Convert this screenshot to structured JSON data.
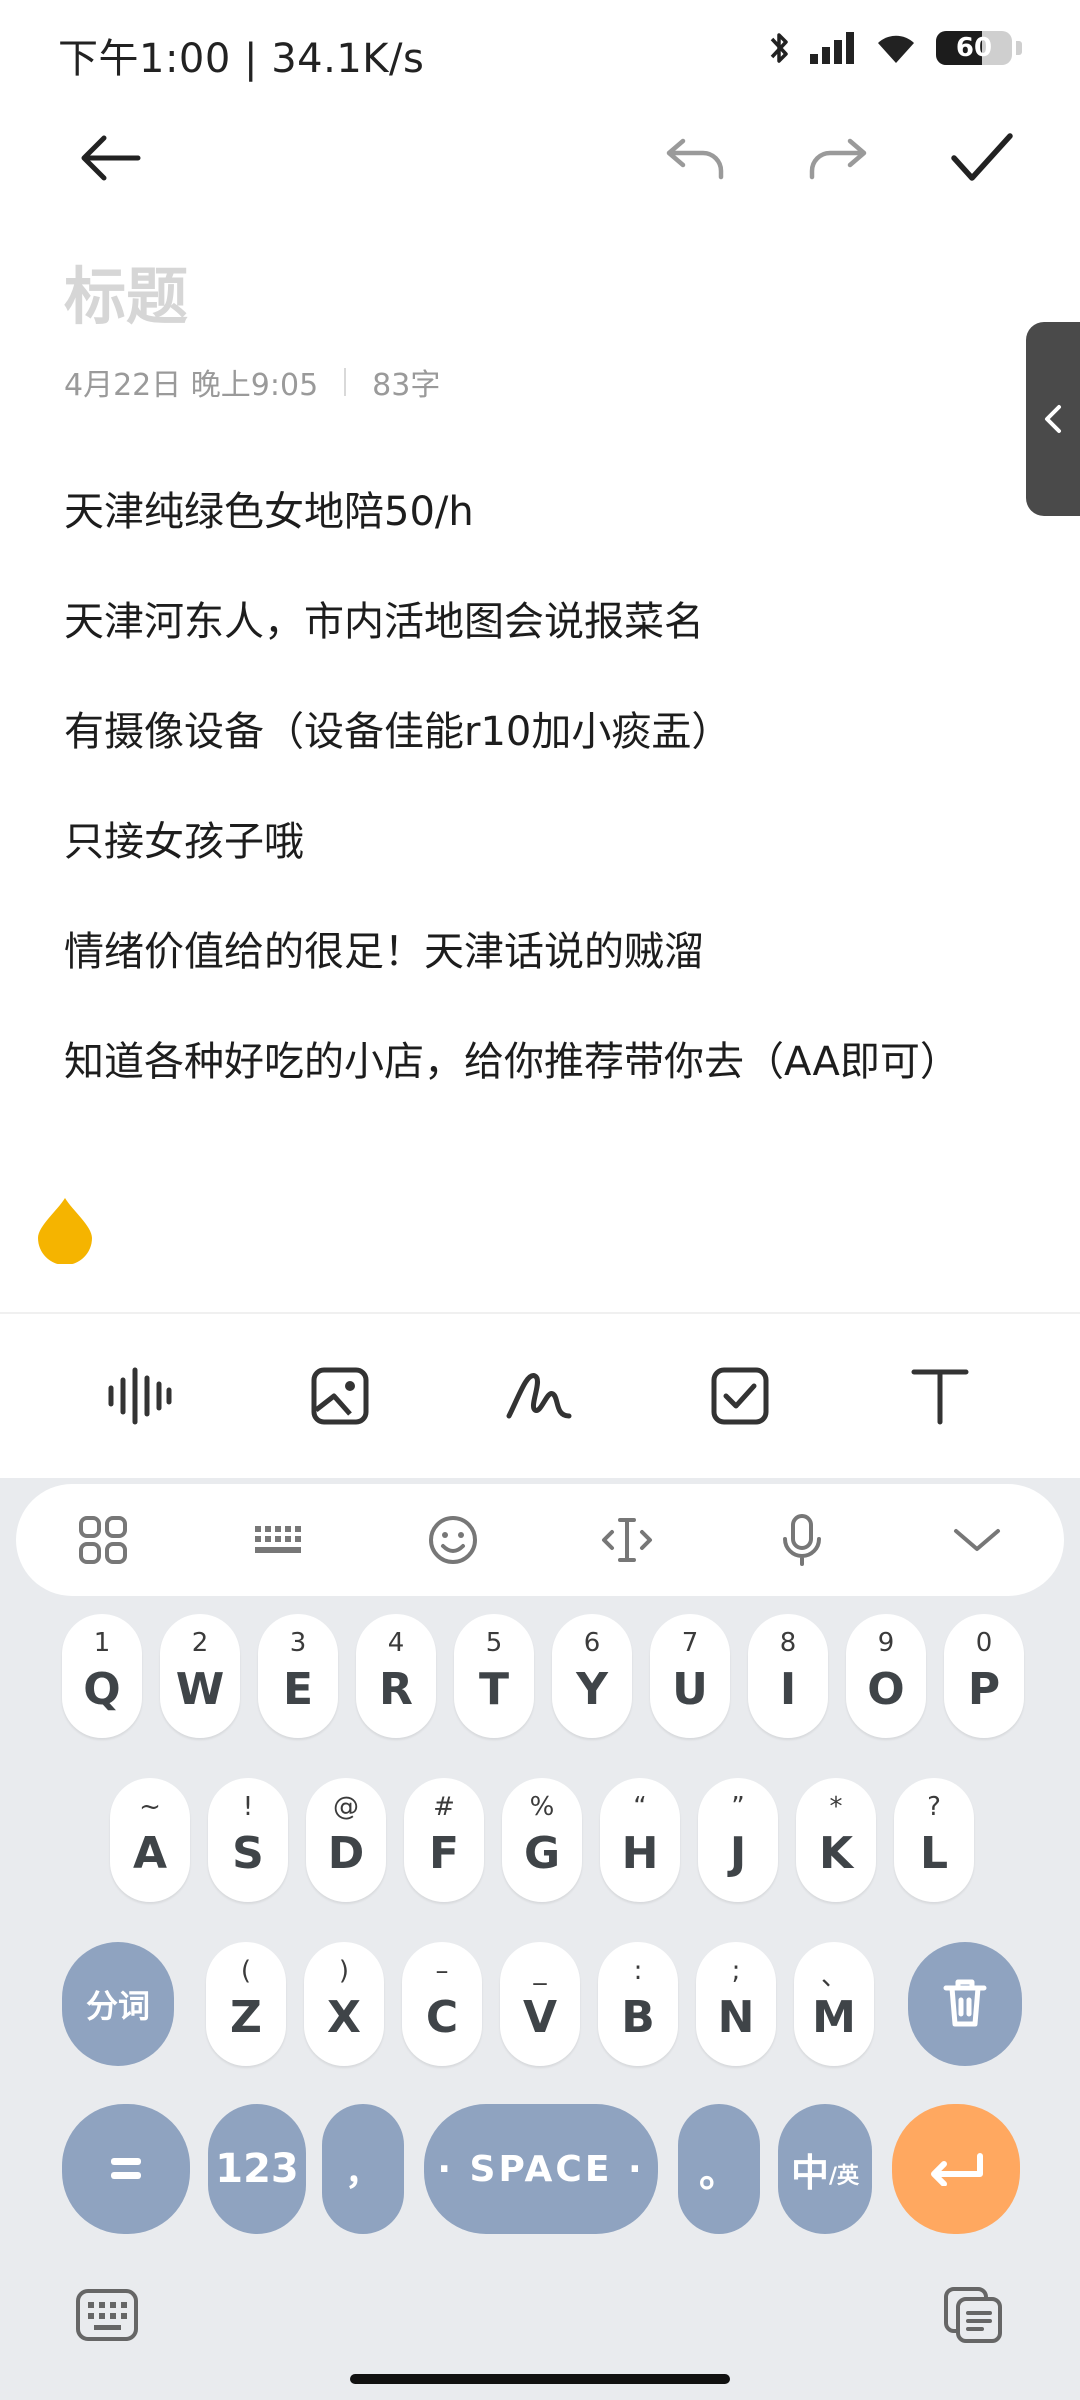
{
  "status": {
    "time_speed": "下午1:00 | 34.1K/s",
    "battery": "60"
  },
  "editor": {
    "title_placeholder": "标题",
    "date": "4月22日 晚上9:05",
    "word_count": "83字",
    "lines": [
      "天津纯绿色女地陪50/h",
      "天津河东人，市内活地图会说报菜名",
      "有摄像设备（设备佳能r10加小痰盂）",
      "只接女孩子哦",
      "情绪价值给的很足！天津话说的贼溜",
      "知道各种好吃的小店，给你推荐带你去（AA即可）"
    ]
  },
  "keyboard": {
    "row1": [
      {
        "k": "Q",
        "s": "1"
      },
      {
        "k": "W",
        "s": "2"
      },
      {
        "k": "E",
        "s": "3"
      },
      {
        "k": "R",
        "s": "4"
      },
      {
        "k": "T",
        "s": "5"
      },
      {
        "k": "Y",
        "s": "6"
      },
      {
        "k": "U",
        "s": "7"
      },
      {
        "k": "I",
        "s": "8"
      },
      {
        "k": "O",
        "s": "9"
      },
      {
        "k": "P",
        "s": "0"
      }
    ],
    "row2": [
      {
        "k": "A",
        "s": "~"
      },
      {
        "k": "S",
        "s": "!"
      },
      {
        "k": "D",
        "s": "@"
      },
      {
        "k": "F",
        "s": "#"
      },
      {
        "k": "G",
        "s": "%"
      },
      {
        "k": "H",
        "s": "“"
      },
      {
        "k": "J",
        "s": "”"
      },
      {
        "k": "K",
        "s": "*"
      },
      {
        "k": "L",
        "s": "?"
      }
    ],
    "row3": [
      {
        "k": "Z",
        "s": "("
      },
      {
        "k": "X",
        "s": ")"
      },
      {
        "k": "C",
        "s": "–"
      },
      {
        "k": "V",
        "s": "_"
      },
      {
        "k": "B",
        "s": ":"
      },
      {
        "k": "N",
        "s": ";"
      },
      {
        "k": "M",
        "s": "、"
      }
    ],
    "segment_label": "分词",
    "num_label": "123",
    "comma_label": "，",
    "space_label": "· SPACE ·",
    "period_label": "。",
    "lang_label_main": "中",
    "lang_label_sub": "/英"
  },
  "colors": {
    "accent_orange": "#ffa860",
    "func_key": "#8fa3c0",
    "drop": "#f5b400"
  }
}
